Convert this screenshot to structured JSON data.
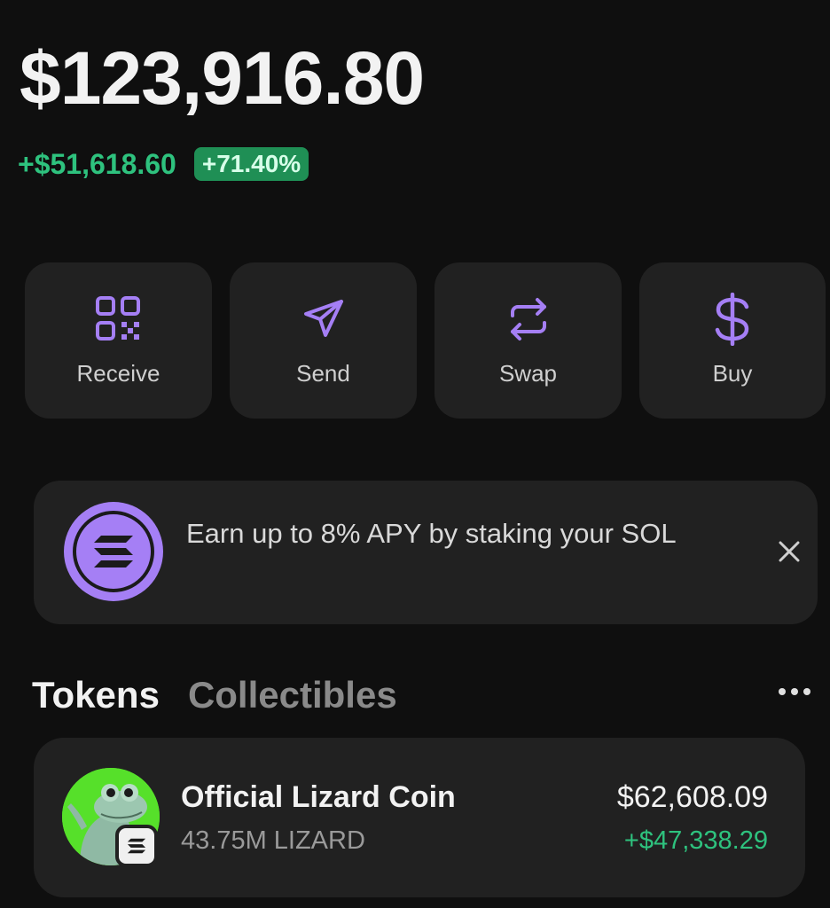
{
  "portfolio": {
    "balance": "$123,916.80",
    "change_amount": "+$51,618.60",
    "change_percent": "+71.40%"
  },
  "actions": [
    {
      "label": "Receive",
      "icon": "qr-code-icon"
    },
    {
      "label": "Send",
      "icon": "send-arrow-icon"
    },
    {
      "label": "Swap",
      "icon": "swap-arrows-icon"
    },
    {
      "label": "Buy",
      "icon": "dollar-icon"
    }
  ],
  "promo": {
    "text": "Earn up to 8% APY by staking your SOL",
    "icon": "solana-logo-icon",
    "close_icon": "close-icon"
  },
  "tabs": {
    "tokens": "Tokens",
    "collectibles": "Collectibles",
    "more_icon": "more-horizontal-icon"
  },
  "tokens": [
    {
      "name": "Official Lizard Coin",
      "amount": "43.75M LIZARD",
      "value": "$62,608.09",
      "pnl": "+$47,338.29"
    }
  ],
  "colors": {
    "background": "#0f0f0f",
    "card": "#212121",
    "accent_purple": "#a57ff5",
    "positive_green": "#2ec27e"
  }
}
